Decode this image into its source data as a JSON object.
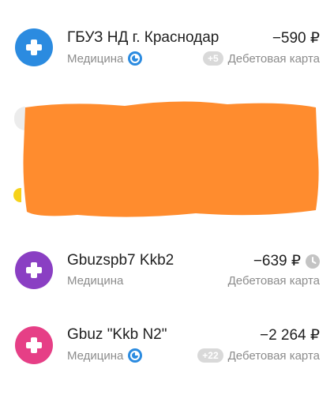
{
  "transactions": [
    {
      "name": "ГБУЗ НД г. Краснодар",
      "category": "Медицина",
      "amount": "−590 ₽",
      "method": "Дебетовая карта",
      "badge": "+5",
      "avatar_color": "#2b8be0",
      "category_icon": "pie-chart-icon"
    },
    {
      "name": "Gbuzspb7 Kkb2",
      "category": "Медицина",
      "amount": "−639 ₽",
      "method": "Дебетовая карта",
      "avatar_color": "#8a3fc3",
      "status_icon": "clock-icon"
    },
    {
      "name": "Gbuz \"Kkb N2\"",
      "category": "Медицина",
      "amount": "−2 264 ₽",
      "method": "Дебетовая карта",
      "badge": "+22",
      "avatar_color": "#e63f86",
      "category_icon": "pie-chart-icon"
    }
  ],
  "colors": {
    "redaction": "#ff8c2e",
    "accent_blue": "#2b8be0",
    "muted_text": "#8c8c8c",
    "badge_bg": "#d9d9d9"
  }
}
